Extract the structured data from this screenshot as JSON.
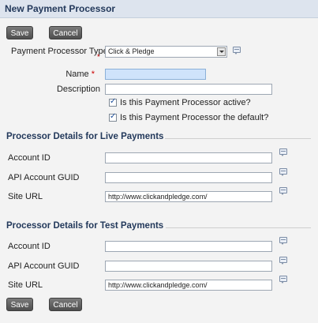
{
  "header": {
    "title": "New Payment Processor"
  },
  "buttons": {
    "save": "Save",
    "cancel": "Cancel"
  },
  "form": {
    "processor_type": {
      "label": "Payment Processor Type",
      "value": "Click & Pledge"
    },
    "name": {
      "label": "Name",
      "value": ""
    },
    "description": {
      "label": "Description",
      "value": ""
    },
    "active_checkbox": {
      "label": "Is this Payment Processor active?",
      "checked": true
    },
    "default_checkbox": {
      "label": "Is this Payment Processor the default?",
      "checked": true
    }
  },
  "live": {
    "heading": "Processor Details for Live Payments",
    "account_id_label": "Account ID",
    "api_guid_label": "API Account GUID",
    "site_url_label": "Site URL",
    "account_id_value": "",
    "api_guid_value": "",
    "site_url_value": "http://www.clickandpledge.com/"
  },
  "test": {
    "heading": "Processor Details for Test Payments",
    "account_id_label": "Account ID",
    "api_guid_label": "API Account GUID",
    "site_url_label": "Site URL",
    "account_id_value": "",
    "api_guid_value": "",
    "site_url_value": "http://www.clickandpledge.com/"
  },
  "icons": {
    "help": "help-bubble-icon",
    "check": "checkmark-icon",
    "dropdown": "chevron-down-icon"
  },
  "colors": {
    "header_bg": "#dde4ee",
    "title": "#23395b",
    "focus_field": "#cfe3fb"
  }
}
